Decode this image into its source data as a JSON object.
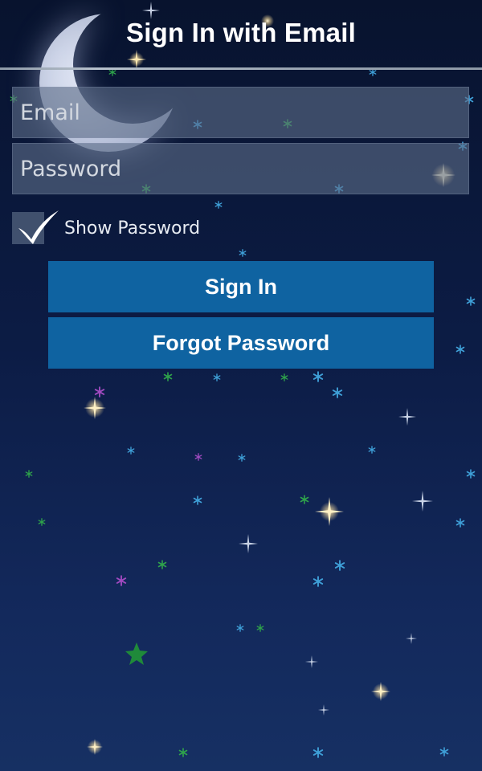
{
  "header": {
    "title": "Sign In with Email"
  },
  "form": {
    "email_placeholder": "Email",
    "email_value": "",
    "password_placeholder": "Password",
    "password_value": "",
    "show_password_label": "Show Password",
    "show_password_checked": true
  },
  "actions": {
    "sign_in_label": "Sign In",
    "forgot_password_label": "Forgot Password"
  },
  "colors": {
    "background_top": "#08132e",
    "background_bottom": "#163063",
    "button": "#0f63a1",
    "field": "#5c6c87"
  },
  "decorations": {
    "moon": "crescent-moon",
    "stars": "starry-night-sky"
  }
}
